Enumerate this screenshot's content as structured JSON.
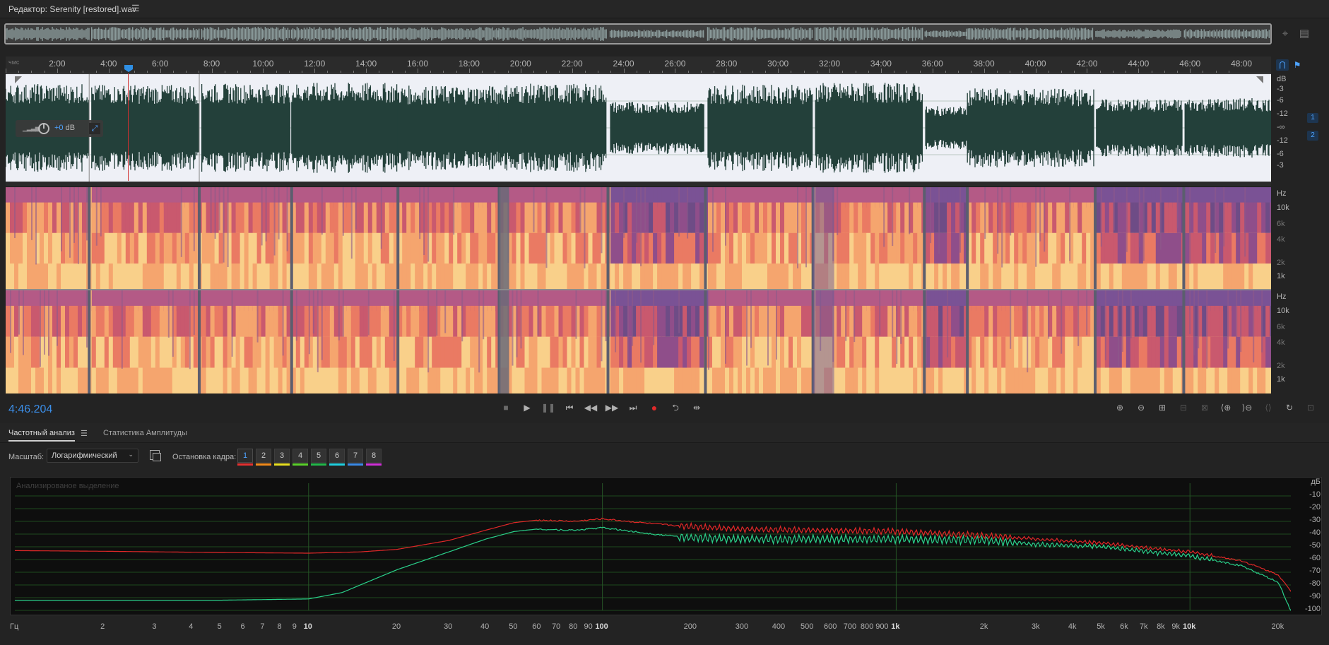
{
  "window": {
    "title": "Редактор: Serenity [restored].wav",
    "menu_icon": "hamburger-icon"
  },
  "ruler": {
    "start_label": "чмс",
    "ticks": [
      "2:00",
      "4:00",
      "6:00",
      "8:00",
      "10:00",
      "12:00",
      "14:00",
      "16:00",
      "18:00",
      "20:00",
      "22:00",
      "24:00",
      "26:00",
      "28:00",
      "30:00",
      "32:00",
      "34:00",
      "36:00",
      "38:00",
      "40:00",
      "42:00",
      "44:00",
      "46:00",
      "48:00"
    ]
  },
  "waveform": {
    "hud_gain_value": "+0",
    "hud_gain_unit": "dB",
    "db_scale": [
      "dB",
      "-3",
      "-6",
      "-12",
      "-∞",
      "-12",
      "-6",
      "-3"
    ],
    "channels": [
      "1",
      "2"
    ]
  },
  "spectral": {
    "scale_labels": [
      "Hz",
      "10k",
      "6k",
      "4k",
      "2k",
      "1k"
    ]
  },
  "transport": {
    "time": "4:46.204",
    "buttons": [
      "stop",
      "play",
      "pause",
      "go-to-start",
      "rewind",
      "fast-forward",
      "go-to-end",
      "record",
      "loop",
      "skip-selection"
    ]
  },
  "panel": {
    "tabs": [
      {
        "label": "Частотный анализ",
        "active": true
      },
      {
        "label": "Статистика Амплитуды",
        "active": false
      }
    ],
    "scale_label": "Масштаб:",
    "scale_value": "Логарифмический",
    "freeze_label": "Остановка кадра:",
    "freeze_buttons": [
      {
        "label": "1",
        "color": "#e53030"
      },
      {
        "label": "2",
        "color": "#f28a1a"
      },
      {
        "label": "3",
        "color": "#e8e020"
      },
      {
        "label": "4",
        "color": "#5ad02a"
      },
      {
        "label": "5",
        "color": "#22b84a"
      },
      {
        "label": "6",
        "color": "#20d0e0"
      },
      {
        "label": "7",
        "color": "#3a8ae8"
      },
      {
        "label": "8",
        "color": "#d030d8"
      }
    ],
    "analysis_note": "Анализированое выделение",
    "db_unit": "дБ",
    "db_ticks": [
      "-10",
      "-20",
      "-30",
      "-40",
      "-50",
      "-60",
      "-70",
      "-80",
      "-90",
      "-100"
    ],
    "freq_ticks": [
      {
        "label": "Гц",
        "hz": 1
      },
      {
        "label": "2",
        "hz": 2
      },
      {
        "label": "3",
        "hz": 3
      },
      {
        "label": "4",
        "hz": 4
      },
      {
        "label": "5",
        "hz": 5
      },
      {
        "label": "6",
        "hz": 6
      },
      {
        "label": "7",
        "hz": 7
      },
      {
        "label": "8",
        "hz": 8
      },
      {
        "label": "9",
        "hz": 9
      },
      {
        "label": "10",
        "hz": 10,
        "major": true
      },
      {
        "label": "20",
        "hz": 20
      },
      {
        "label": "30",
        "hz": 30
      },
      {
        "label": "40",
        "hz": 40
      },
      {
        "label": "50",
        "hz": 50
      },
      {
        "label": "60",
        "hz": 60
      },
      {
        "label": "70",
        "hz": 70
      },
      {
        "label": "80",
        "hz": 80
      },
      {
        "label": "90",
        "hz": 90
      },
      {
        "label": "100",
        "hz": 100,
        "major": true
      },
      {
        "label": "200",
        "hz": 200
      },
      {
        "label": "300",
        "hz": 300
      },
      {
        "label": "400",
        "hz": 400
      },
      {
        "label": "500",
        "hz": 500
      },
      {
        "label": "600",
        "hz": 600
      },
      {
        "label": "700",
        "hz": 700
      },
      {
        "label": "800",
        "hz": 800
      },
      {
        "label": "900",
        "hz": 900
      },
      {
        "label": "1k",
        "hz": 1000,
        "major": true
      },
      {
        "label": "2k",
        "hz": 2000
      },
      {
        "label": "3k",
        "hz": 3000
      },
      {
        "label": "4k",
        "hz": 4000
      },
      {
        "label": "5k",
        "hz": 5000
      },
      {
        "label": "6k",
        "hz": 6000
      },
      {
        "label": "7k",
        "hz": 7000
      },
      {
        "label": "8k",
        "hz": 8000
      },
      {
        "label": "9k",
        "hz": 9000
      },
      {
        "label": "10k",
        "hz": 10000,
        "major": true
      },
      {
        "label": "20k",
        "hz": 20000
      }
    ]
  },
  "chart_data": {
    "type": "line",
    "xlabel": "Гц",
    "ylabel": "дБ",
    "x_scale": "log",
    "xlim": [
      1,
      22050
    ],
    "ylim": [
      -100,
      0
    ],
    "series": [
      {
        "color": "#e02828",
        "x": [
          1,
          2,
          5,
          10,
          15,
          20,
          30,
          40,
          50,
          60,
          80,
          100,
          150,
          200,
          300,
          500,
          1000,
          2000,
          3000,
          5000,
          8000,
          10000,
          15000,
          20000,
          22000
        ],
        "values": [
          -53,
          -53.5,
          -54.5,
          -55,
          -54,
          -52,
          -45,
          -37,
          -31,
          -29,
          -30,
          -28,
          -32,
          -34,
          -36,
          -37,
          -38,
          -41,
          -44,
          -47,
          -52,
          -54,
          -61,
          -72,
          -85
        ]
      },
      {
        "color": "#2ad08a",
        "x": [
          1,
          2,
          5,
          10,
          13,
          15,
          20,
          30,
          40,
          50,
          60,
          80,
          100,
          150,
          200,
          300,
          500,
          1000,
          2000,
          3000,
          5000,
          8000,
          10000,
          15000,
          20000,
          22000
        ],
        "values": [
          -92,
          -92,
          -92,
          -91,
          -86,
          -80,
          -68,
          -54,
          -44,
          -38,
          -36,
          -37,
          -35,
          -40,
          -43,
          -44,
          -44,
          -44,
          -45,
          -48,
          -50,
          -55,
          -57,
          -65,
          -78,
          -100
        ]
      }
    ]
  }
}
